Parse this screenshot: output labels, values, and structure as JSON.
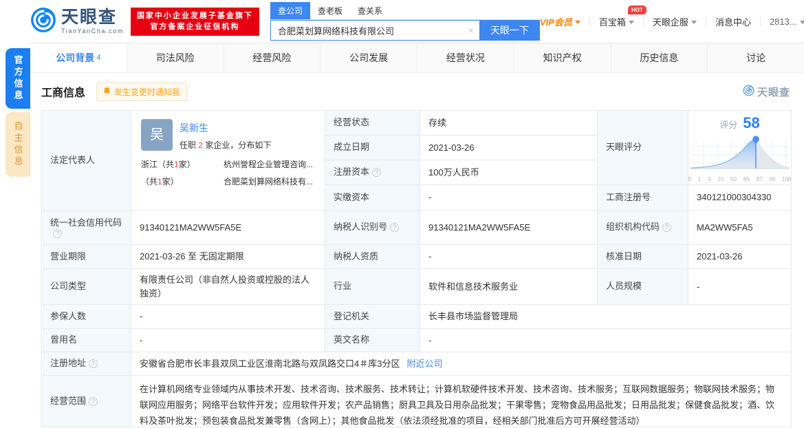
{
  "colors": {
    "accent": "#3e86f0",
    "brand_red": "#e60012",
    "vip_orange": "#ff8000",
    "label_bg": "#f3f9fd",
    "side_blue": "#1b7ef2",
    "side_tan": "#fbe7c3"
  },
  "icons": {
    "question": "?",
    "clear": "×"
  },
  "header": {
    "logo": {
      "title": "天眼查",
      "subtitle": "TianYanCha.com"
    },
    "gov_badge": {
      "line1": "国家中小企业发展子基金旗下",
      "line2": "官方备案企业征信机构"
    },
    "search": {
      "tabs": [
        {
          "label": "查公司"
        },
        {
          "label": "查老板"
        },
        {
          "label": "查关系"
        }
      ],
      "value": "合肥菜划算网络科技有限公司",
      "button": "天眼一下"
    },
    "menu": {
      "vip": "VIP会员",
      "treasure": "百宝箱",
      "hot": "HOT",
      "qifu": "天眼企服",
      "messages": "消息中心",
      "user": "2813..."
    }
  },
  "nav": {
    "tabs": [
      {
        "label": "公司背景",
        "count": "4"
      },
      {
        "label": "司法风险"
      },
      {
        "label": "经营风险"
      },
      {
        "label": "公司发展"
      },
      {
        "label": "经营状况"
      },
      {
        "label": "知识产权"
      },
      {
        "label": "历史信息"
      },
      {
        "label": "讨论"
      }
    ]
  },
  "side_tabs": {
    "official": "官方信息",
    "self": "自主信息"
  },
  "section": {
    "title": "工商信息",
    "notify": "发生变更时通知我",
    "watermark": "天眼查"
  },
  "legal_rep": {
    "label": "法定代表人",
    "avatar_char": "吴",
    "name": "吴新生",
    "tenure_prefix": "任职 ",
    "tenure_count": "2",
    "tenure_suffix": " 家企业，分布如下",
    "regions": [
      {
        "left_pre": "浙江（共",
        "num": "1",
        "left_post": "家）",
        "company": "杭州誉程企业管理咨询..."
      },
      {
        "left_pre": "（共",
        "num": "1",
        "left_post": "家）",
        "company": "合肥菜划算网络科技有..."
      }
    ]
  },
  "score": {
    "label": "天眼评分",
    "caption": "评分",
    "value": "58",
    "axis": [
      "0",
      "1",
      "3",
      "15",
      "50",
      "85",
      "97",
      "99",
      "100"
    ]
  },
  "fields": {
    "status": {
      "label": "经营状态",
      "value": "存续"
    },
    "established": {
      "label": "成立日期",
      "value": "2021-03-26"
    },
    "reg_capital": {
      "label": "注册资本",
      "value": "100万人民币"
    },
    "paid_capital": {
      "label": "实缴资本",
      "value": "-"
    },
    "reg_number": {
      "label": "工商注册号",
      "value": "340121000304330"
    },
    "credit_code": {
      "label": "统一社会信用代码",
      "value": "91340121MA2WW5FA5E"
    },
    "taxpayer_id": {
      "label": "纳税人识别号",
      "value": "91340121MA2WW5FA5E"
    },
    "org_code": {
      "label": "组织机构代码",
      "value": "MA2WW5FA5"
    },
    "term": {
      "label": "营业期限",
      "value": "2021-03-26 至 无固定期限"
    },
    "taxpayer_quality": {
      "label": "纳税人资质",
      "value": "-"
    },
    "approved_date": {
      "label": "核准日期",
      "value": "2021-03-26"
    },
    "company_type": {
      "label": "公司类型",
      "value": "有限责任公司（非自然人投资或控股的法人独资）"
    },
    "industry": {
      "label": "行业",
      "value": "软件和信息技术服务业"
    },
    "staff_size": {
      "label": "人员规模",
      "value": "-"
    },
    "insured_count": {
      "label": "参保人数",
      "value": "-"
    },
    "registry": {
      "label": "登记机关",
      "value": "长丰县市场监督管理局"
    },
    "former_name": {
      "label": "曾用名",
      "value": "-"
    },
    "english_name": {
      "label": "英文名称",
      "value": "-"
    },
    "address": {
      "label": "注册地址",
      "value": "安徽省合肥市长丰县双凤工业区淮南北路与双凤路交口4＃库3分区",
      "link": "附近公司"
    },
    "business_scope": {
      "label": "经营范围",
      "value": "在计算机网络专业领域内从事技术开发、技术咨询、技术服务、技术转让；计算机软硬件技术开发、技术咨询、技术服务；互联网数据服务；物联网技术服务；物联网应用服务；网络平台软件开发；应用软件开发；农产品销售；厨具卫具及日用杂品批发；干果零售；宠物食品用品批发；日用品批发；保健食品批发；酒、饮料及茶叶批发；预包装食品批发兼零售（含网上）；其他食品批发（依法须经批准的项目，经相关部门批准后方可开展经营活动）"
    }
  }
}
